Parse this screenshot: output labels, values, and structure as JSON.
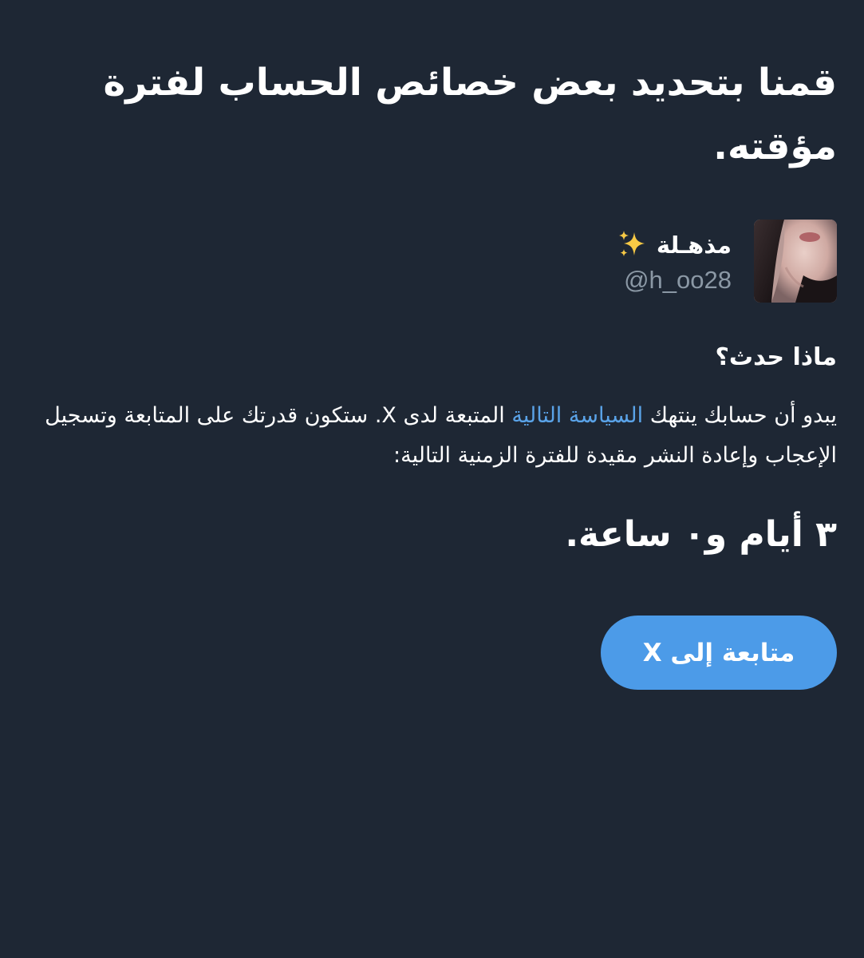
{
  "notice": {
    "headline": "قمنا بتحديد بعض خصائص الحساب لفترة مؤقته."
  },
  "profile": {
    "display_name": "مذهـلة",
    "name_emoji": "sparkles-icon",
    "handle": "@h_oo28"
  },
  "details": {
    "section_title": "ماذا حدث؟",
    "body_before_link": "يبدو أن حسابك ينتهك ",
    "policy_link": "السياسة التالية",
    "body_after_link": " المتبعة لدى X. ستكون قدرتك على المتابعة وتسجيل الإعجاب وإعادة النشر مقيدة للفترة الزمنية التالية:",
    "duration": "٣ أيام و٠ ساعة."
  },
  "actions": {
    "continue_label": "متابعة إلى X"
  },
  "colors": {
    "background": "#1e2734",
    "link": "#5aa3e8",
    "button": "#4c9be8",
    "secondary_text": "#8b98a5"
  }
}
